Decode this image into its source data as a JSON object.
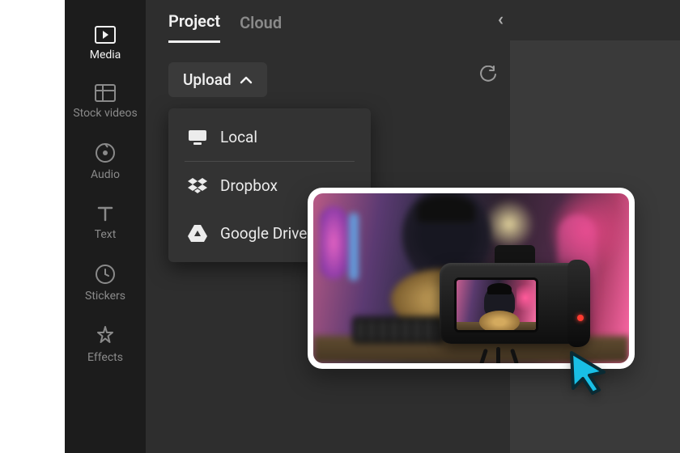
{
  "sidebar": {
    "items": [
      {
        "label": "Media",
        "icon": "media-play-icon",
        "active": true
      },
      {
        "label": "Stock videos",
        "icon": "stock-grid-icon",
        "active": false
      },
      {
        "label": "Audio",
        "icon": "audio-disc-icon",
        "active": false
      },
      {
        "label": "Text",
        "icon": "text-icon",
        "active": false
      },
      {
        "label": "Stickers",
        "icon": "stickers-clock-icon",
        "active": false
      },
      {
        "label": "Effects",
        "icon": "effects-star-icon",
        "active": false
      }
    ]
  },
  "tabs": {
    "project": "Project",
    "cloud": "Cloud"
  },
  "upload": {
    "button_label": "Upload",
    "menu": [
      {
        "label": "Local",
        "icon": "local-computer-icon"
      },
      {
        "label": "Dropbox",
        "icon": "dropbox-icon"
      },
      {
        "label": "Google Drive",
        "icon": "google-drive-icon"
      }
    ]
  },
  "thumbnail": {
    "description": "Person with hat playing guitar, recorded by DSLR camera in neon-lit studio"
  },
  "colors": {
    "bg_dark": "#1c1c1c",
    "bg_panel": "#2e2e2e",
    "bg_elev": "#333333",
    "text_primary": "#f2f2f2",
    "text_muted": "#8a8a8a",
    "cursor_fill": "#19bfe5",
    "cursor_stroke": "#0a2a33"
  }
}
